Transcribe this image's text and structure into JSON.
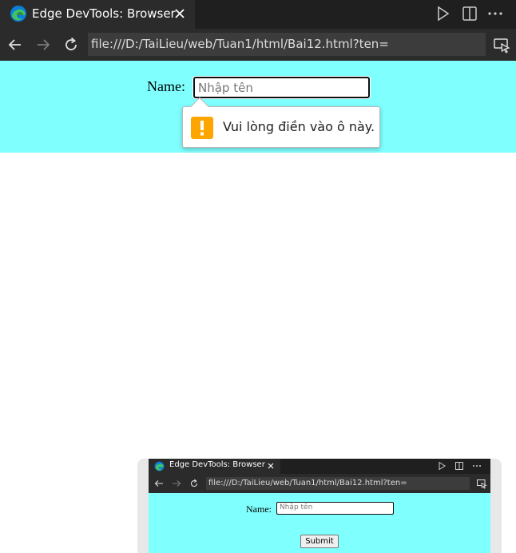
{
  "window": {
    "tab_title": "Edge DevTools: Browser",
    "url": "file:///D:/TaiLieu/web/Tuan1/html/Bai12.html?ten=",
    "icons": {
      "logo": "edge-logo-icon",
      "close": "close-icon",
      "run": "play-icon",
      "split": "split-editor-icon",
      "more": "more-icon",
      "back": "back-arrow-icon",
      "forward": "forward-arrow-icon",
      "reload": "reload-icon",
      "inspect": "inspect-screencast-icon"
    }
  },
  "page": {
    "form": {
      "name_label": "Name:",
      "name_placeholder": "Nhập tên",
      "name_value": ""
    },
    "validation_tooltip": {
      "message": "Vui lòng điền vào ô này.",
      "icon": "warning-icon"
    },
    "background_color": "#80ffff"
  },
  "thumbnail": {
    "tab_title": "Edge DevTools: Browser",
    "url": "file:///D:/TaiLieu/web/Tuan1/html/Bai12.html?ten=",
    "name_label": "Name:",
    "name_placeholder": "Nhập tên",
    "submit_label": "Submit"
  },
  "colors": {
    "titlebar": "#1f1f1f",
    "tab": "#2b2b2b",
    "warning": "#ffa500",
    "edge_blue": "#0c7fd6",
    "edge_green": "#41c463"
  }
}
